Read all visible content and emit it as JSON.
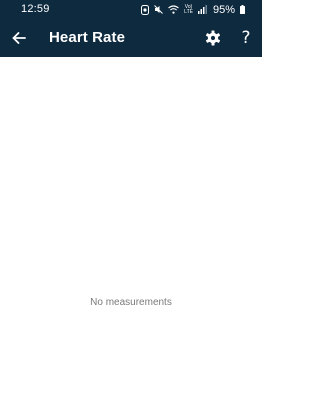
{
  "status_bar": {
    "time": "12:59",
    "lte_top": "Vo)",
    "lte_bottom": "LTE",
    "battery_percent": "95%",
    "icons": [
      "sync-icon",
      "mute-icon",
      "wifi-icon",
      "volte-icon",
      "signal-icon",
      "battery-icon"
    ]
  },
  "app_bar": {
    "title": "Heart Rate",
    "back_icon": "arrow-left-icon",
    "settings_icon": "gear-icon",
    "help_label": "?",
    "background": "#0e2a3f"
  },
  "main": {
    "empty_message": "No measurements",
    "message_color": "#7a7a7a"
  }
}
